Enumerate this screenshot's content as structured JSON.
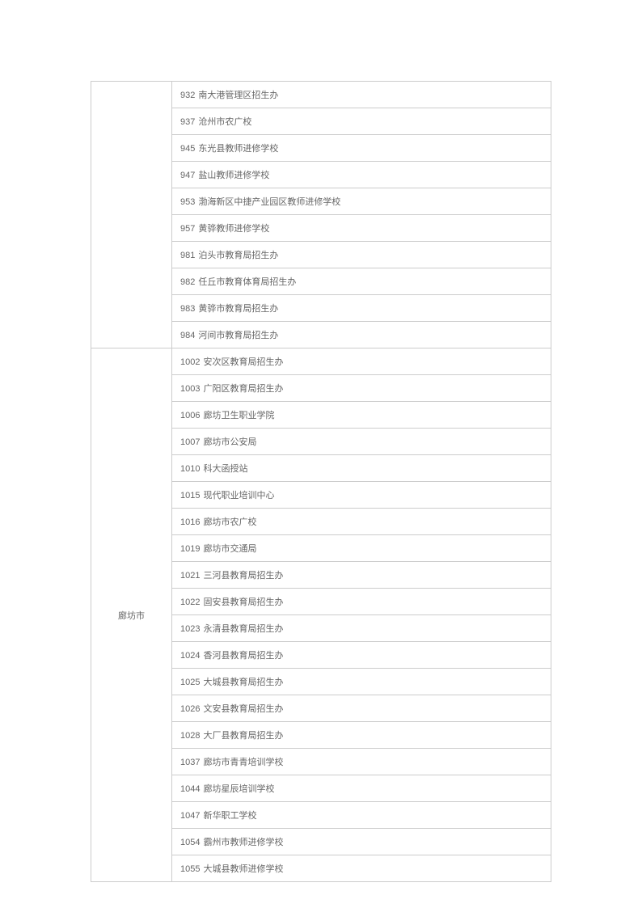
{
  "groups": [
    {
      "region": "",
      "rows": [
        {
          "code": "932",
          "name": "南大港管理区招生办"
        },
        {
          "code": "937",
          "name": "沧州市农广校"
        },
        {
          "code": "945",
          "name": "东光县教师进修学校"
        },
        {
          "code": "947",
          "name": "盐山教师进修学校"
        },
        {
          "code": "953",
          "name": "渤海新区中捷产业园区教师进修学校"
        },
        {
          "code": "957",
          "name": "黄骅教师进修学校"
        },
        {
          "code": "981",
          "name": "泊头市教育局招生办"
        },
        {
          "code": "982",
          "name": "任丘市教育体育局招生办"
        },
        {
          "code": "983",
          "name": "黄骅市教育局招生办"
        },
        {
          "code": "984",
          "name": "河间市教育局招生办"
        }
      ]
    },
    {
      "region": "廊坊市",
      "rows": [
        {
          "code": "1002",
          "name": "安次区教育局招生办"
        },
        {
          "code": "1003",
          "name": "广阳区教育局招生办"
        },
        {
          "code": "1006",
          "name": "廊坊卫生职业学院"
        },
        {
          "code": "1007",
          "name": "廊坊市公安局"
        },
        {
          "code": "1010",
          "name": "科大函授站"
        },
        {
          "code": "1015",
          "name": "现代职业培训中心"
        },
        {
          "code": "1016",
          "name": "廊坊市农广校"
        },
        {
          "code": "1019",
          "name": "廊坊市交通局"
        },
        {
          "code": "1021",
          "name": "三河县教育局招生办"
        },
        {
          "code": "1022",
          "name": "固安县教育局招生办"
        },
        {
          "code": "1023",
          "name": "永清县教育局招生办"
        },
        {
          "code": "1024",
          "name": "香河县教育局招生办"
        },
        {
          "code": "1025",
          "name": "大城县教育局招生办"
        },
        {
          "code": "1026",
          "name": "文安县教育局招生办"
        },
        {
          "code": "1028",
          "name": "大厂县教育局招生办"
        },
        {
          "code": "1037",
          "name": "廊坊市青青培训学校"
        },
        {
          "code": "1044",
          "name": "廊坊星辰培训学校"
        },
        {
          "code": "1047",
          "name": "新华职工学校"
        },
        {
          "code": "1054",
          "name": "霸州市教师进修学校"
        },
        {
          "code": "1055",
          "name": "大城县教师进修学校"
        }
      ]
    }
  ]
}
